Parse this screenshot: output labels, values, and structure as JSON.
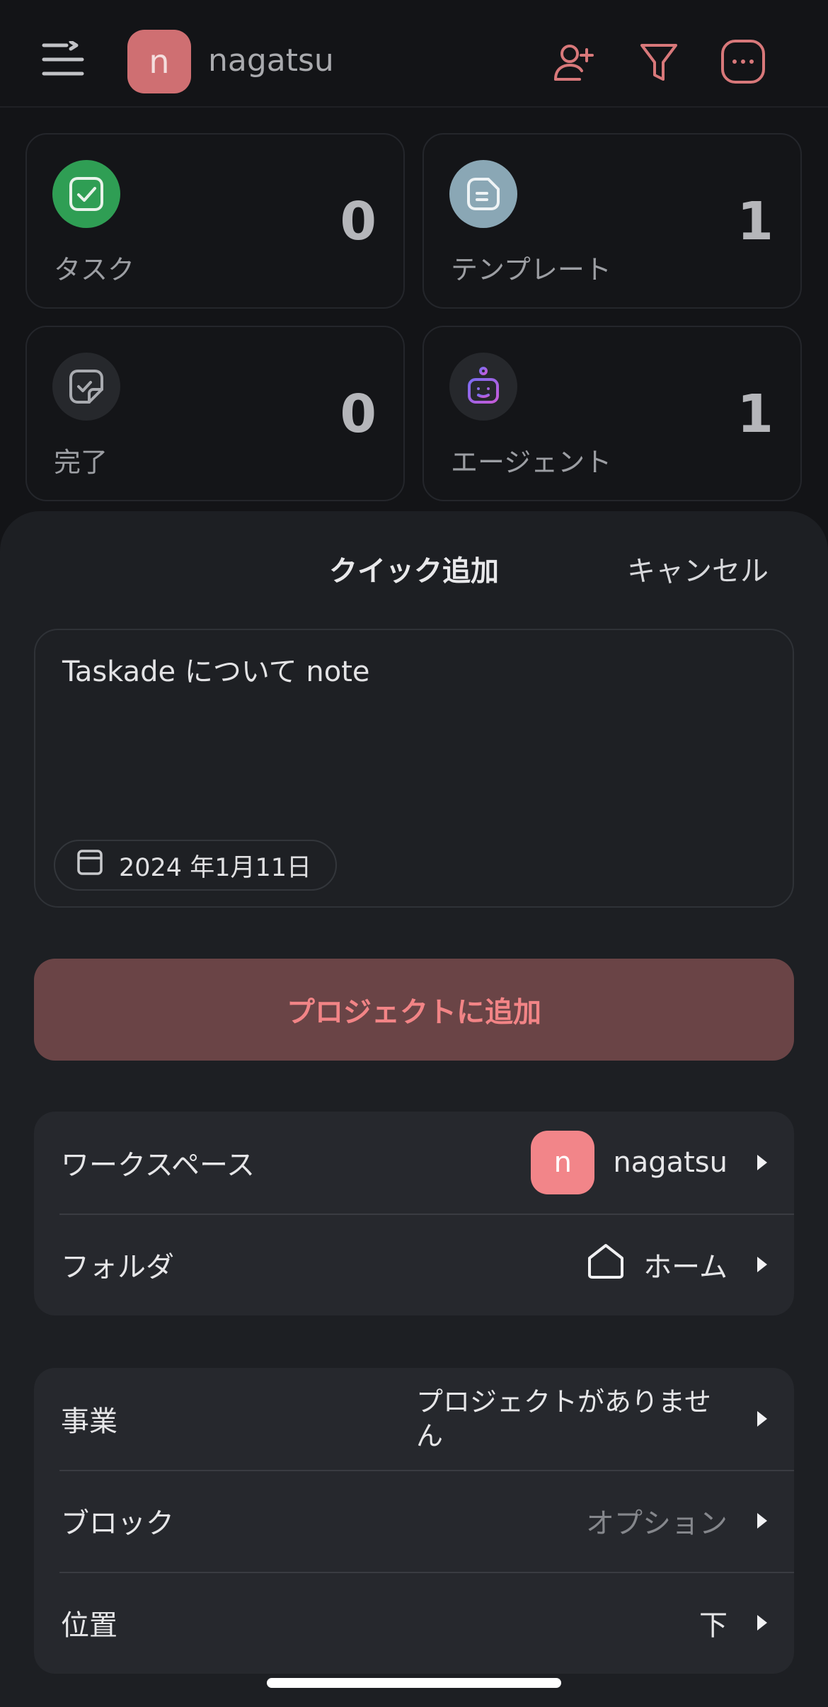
{
  "header": {
    "workspace_initial": "n",
    "workspace_name": "nagatsu",
    "icons": [
      "menu-icon",
      "add-user-icon",
      "filter-icon",
      "more-icon"
    ],
    "accent_color": "#cf6f72"
  },
  "stats": [
    {
      "label": "タスク",
      "count": "0",
      "icon": "check-circle-icon",
      "icon_bg": "#2f9e54"
    },
    {
      "label": "テンプレート",
      "count": "1",
      "icon": "document-icon",
      "icon_bg": "#8aa7b5"
    },
    {
      "label": "完了",
      "count": "0",
      "icon": "completed-note-icon",
      "icon_bg": "#26282c"
    },
    {
      "label": "エージェント",
      "count": "1",
      "icon": "robot-icon",
      "icon_bg": "#26282c"
    }
  ],
  "sheet": {
    "title": "クイック追加",
    "cancel_label": "キャンセル",
    "note_text": "Taskade について note",
    "date_label": "2024 年1月11日",
    "add_button_label": "プロジェクトに追加",
    "location_group": [
      {
        "label": "ワークスペース",
        "value": "nagatsu",
        "avatar_initial": "n"
      },
      {
        "label": "フォルダ",
        "value": "ホーム",
        "icon": "home-icon"
      }
    ],
    "target_group": [
      {
        "label": "事業",
        "value": "プロジェクトがありません"
      },
      {
        "label": "ブロック",
        "value": "オプション"
      },
      {
        "label": "位置",
        "value": "下"
      }
    ]
  }
}
